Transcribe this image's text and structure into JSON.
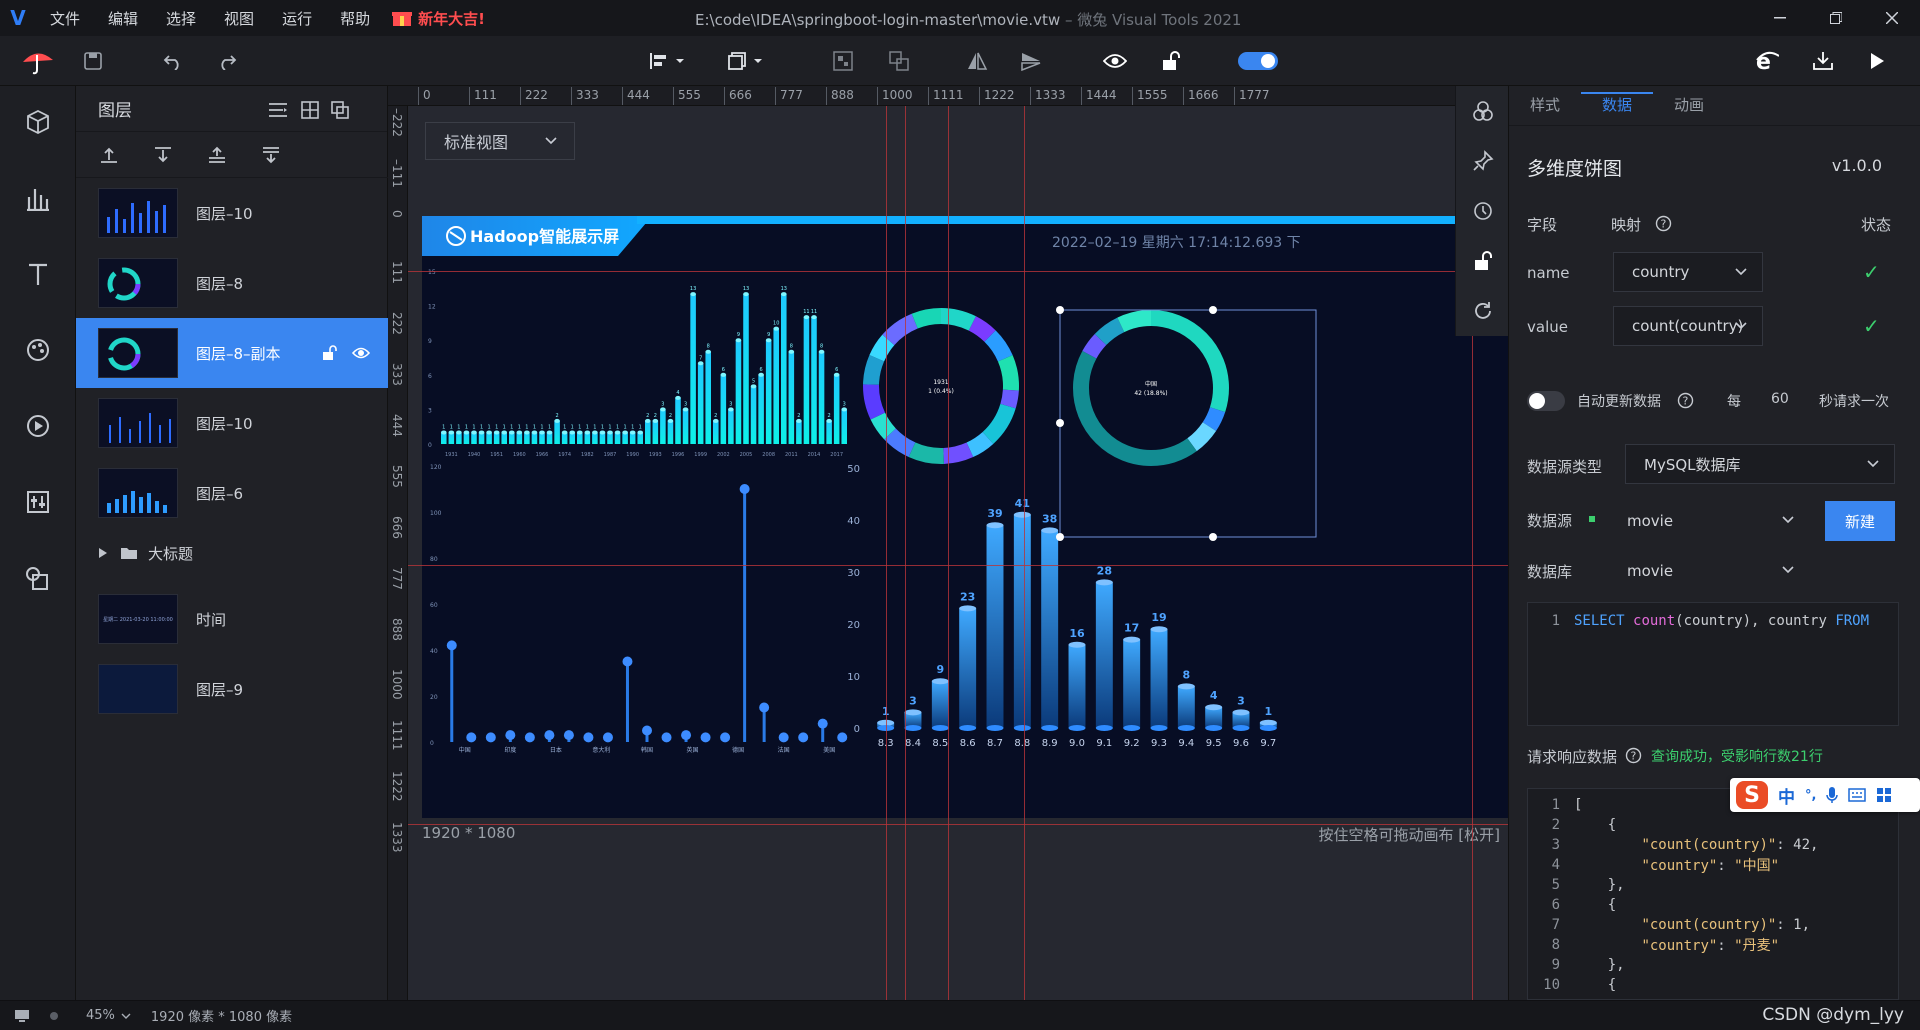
{
  "menu": {
    "logo": "V",
    "items": [
      "文件",
      "编辑",
      "选择",
      "视图",
      "运行",
      "帮助"
    ],
    "promo": "新年大吉!"
  },
  "window": {
    "title": "E:\\code\\IDEA\\springboot-login-master\\movie.vtw",
    "subtitle": " – 微兔 Visual Tools 2021"
  },
  "layers": {
    "title": "图层",
    "items": [
      {
        "label": "图层–10",
        "thumb": "bars"
      },
      {
        "label": "图层–8",
        "thumb": "ring"
      },
      {
        "label": "图层–8–副本",
        "thumb": "ring",
        "active": true
      },
      {
        "label": "图层–10",
        "thumb": "bars-thin"
      },
      {
        "label": "图层–6",
        "thumb": "bars-short"
      },
      {
        "label": "大标题",
        "thumb": "folder"
      },
      {
        "label": "时间",
        "thumb": "time"
      },
      {
        "label": "图层–9",
        "thumb": "dark"
      }
    ],
    "time_thumb_text": "星期二 2021-03-20 11:00:00"
  },
  "canvas": {
    "view_mode": "标准视图",
    "ruler_top": [
      "0",
      "111",
      "222",
      "333",
      "444",
      "555",
      "666",
      "777",
      "888",
      "1000",
      "1111",
      "1222",
      "1333",
      "1444",
      "1555",
      "1666",
      "1777"
    ],
    "ruler_left": [
      "–222",
      "–111",
      "0",
      "111",
      "222",
      "333",
      "444",
      "555",
      "666",
      "777",
      "888",
      "1000",
      "1111",
      "1222",
      "1333"
    ],
    "size_label": "1920 * 1080",
    "hint": "按住空格可拖动画布 [松开]"
  },
  "dashboard": {
    "title": "Hadoop智能展示屏",
    "datetime": "2022–02–19 星期六 17:14:12.693 下",
    "donut1_center": [
      "1931",
      "1 (0.4%)"
    ],
    "donut2_center": [
      "中国",
      "42 (18.8%)"
    ]
  },
  "chart_data": [
    {
      "type": "bar",
      "ylim": [
        0,
        15
      ],
      "yticks": [
        "0",
        "3",
        "6",
        "9",
        "12",
        "15"
      ],
      "xticks": [
        "1931",
        "1940",
        "1951",
        "1960",
        "1966",
        "1974",
        "1982",
        "1987",
        "1990",
        "1993",
        "1996",
        "1999",
        "2002",
        "2005",
        "2008",
        "2011",
        "2014",
        "2017"
      ],
      "values": [
        1,
        1,
        1,
        1,
        1,
        1,
        1,
        1,
        1,
        1,
        1,
        1,
        1,
        1,
        1,
        2,
        1,
        1,
        1,
        1,
        1,
        1,
        1,
        1,
        1,
        1,
        1,
        2,
        2,
        3,
        2,
        4,
        3,
        13,
        7,
        8,
        2,
        6,
        3,
        9,
        13,
        5,
        6,
        9,
        10,
        13,
        8,
        2,
        11,
        11,
        8,
        2,
        6,
        3
      ]
    },
    {
      "type": "scatter",
      "ylim": [
        0,
        120
      ],
      "yticks": [
        "0",
        "20",
        "40",
        "60",
        "80",
        "100",
        "120"
      ],
      "xticks": [
        "中国",
        "印度",
        "日本",
        "意大利",
        "韩国",
        "英国",
        "德国",
        "法国",
        "美国"
      ],
      "values": [
        42,
        2,
        2,
        3,
        2,
        3,
        3,
        2,
        2,
        35,
        5,
        2,
        3,
        2,
        2,
        110,
        15,
        2,
        2,
        8,
        2
      ]
    },
    {
      "type": "bar",
      "ylim": [
        0,
        50
      ],
      "yticks": [
        "0",
        "10",
        "20",
        "30",
        "40",
        "50"
      ],
      "categories": [
        "8.3",
        "8.4",
        "8.5",
        "8.6",
        "8.7",
        "8.8",
        "8.9",
        "9.0",
        "9.1",
        "9.2",
        "9.3",
        "9.4",
        "9.5",
        "9.6",
        "9.7"
      ],
      "values": [
        1,
        3,
        9,
        23,
        39,
        41,
        38,
        16,
        28,
        17,
        19,
        8,
        4,
        3,
        1
      ]
    },
    {
      "type": "pie",
      "note": "donut rings",
      "series": [
        {
          "center": "1931"
        },
        {
          "center": "中国"
        }
      ]
    }
  ],
  "props": {
    "tabs": [
      "样式",
      "数据",
      "动画"
    ],
    "active_tab": "数据",
    "component": "多维度饼图",
    "version": "v1.0.0",
    "field_header": "字段",
    "map_header": "映射",
    "status_header": "状态",
    "fields": [
      {
        "name": "name",
        "value": "country"
      },
      {
        "name": "value",
        "value": "count(country)"
      }
    ],
    "auto_update": "自动更新数据",
    "every": "每",
    "interval": "60",
    "interval_unit": "秒请求一次",
    "source_type_label": "数据源类型",
    "source_type": "MySQL数据库",
    "source_label": "数据源",
    "source": "movie",
    "new_btn": "新建",
    "db_label": "数据库",
    "db": "movie",
    "sql": "SELECT count(country), country FROM",
    "response_label": "请求响应数据",
    "response_status": "查询成功，受影响行数21行",
    "json_lines": [
      "[",
      "    {",
      "        \"count(country)\": 42,",
      "        \"country\": \"中国\"",
      "    },",
      "    {",
      "        \"count(country)\": 1,",
      "        \"country\": \"丹麦\"",
      "    },",
      "    {"
    ]
  },
  "status": {
    "zoom": "45%",
    "size": "1920 像素 * 1080 像素"
  },
  "watermark": "CSDN @dym_lyy",
  "ime": {
    "lang": "中",
    "punct": "°,"
  }
}
